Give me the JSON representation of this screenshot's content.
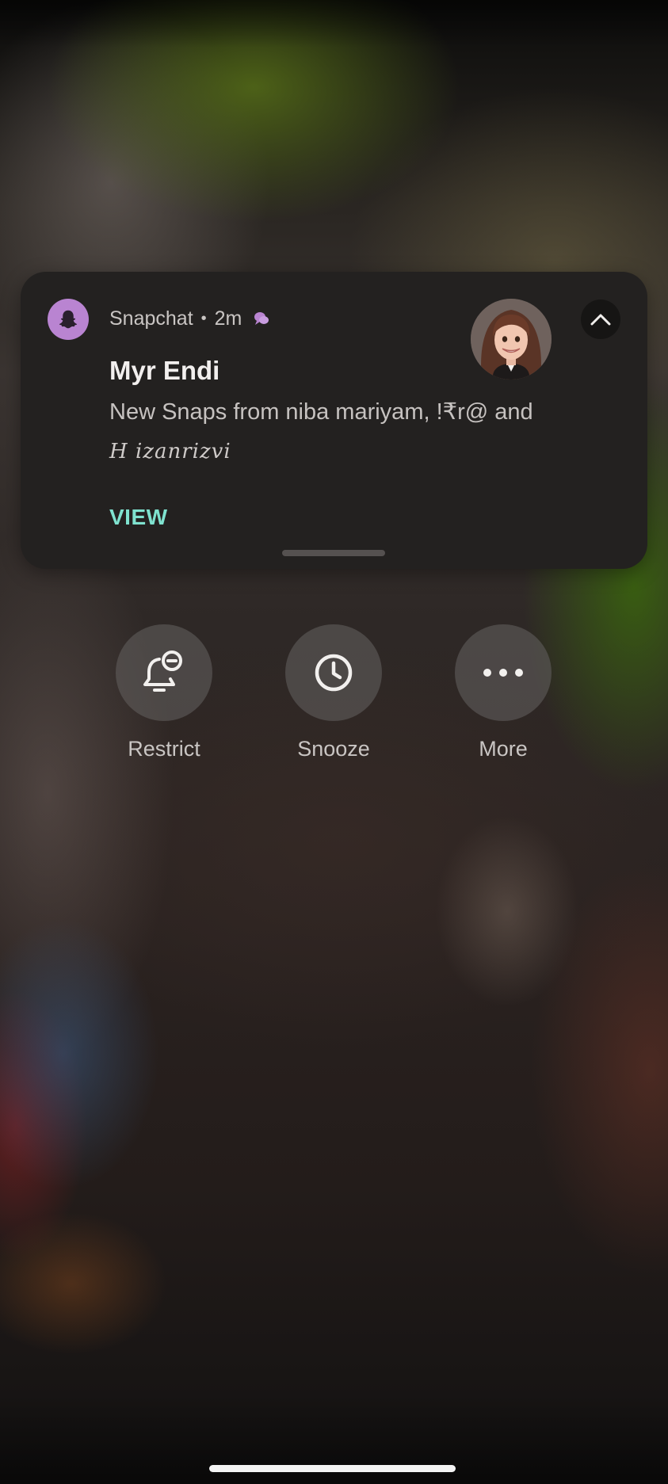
{
  "notification": {
    "app_name": "Snapchat",
    "separator": "•",
    "time_ago": "2m",
    "title": "Myr Endi",
    "message": "New Snaps from niba mariyam, !₹r@ and",
    "message_line2": "H izanrizvi",
    "action_label": "VIEW",
    "app_icon": "snapchat-ghost-icon",
    "accent_color": "#b984d1",
    "action_color": "#7fe2cf"
  },
  "quick_actions": [
    {
      "label": "Restrict",
      "icon": "bell-restrict-icon"
    },
    {
      "label": "Snooze",
      "icon": "clock-icon"
    },
    {
      "label": "More",
      "icon": "more-dots-icon"
    }
  ]
}
